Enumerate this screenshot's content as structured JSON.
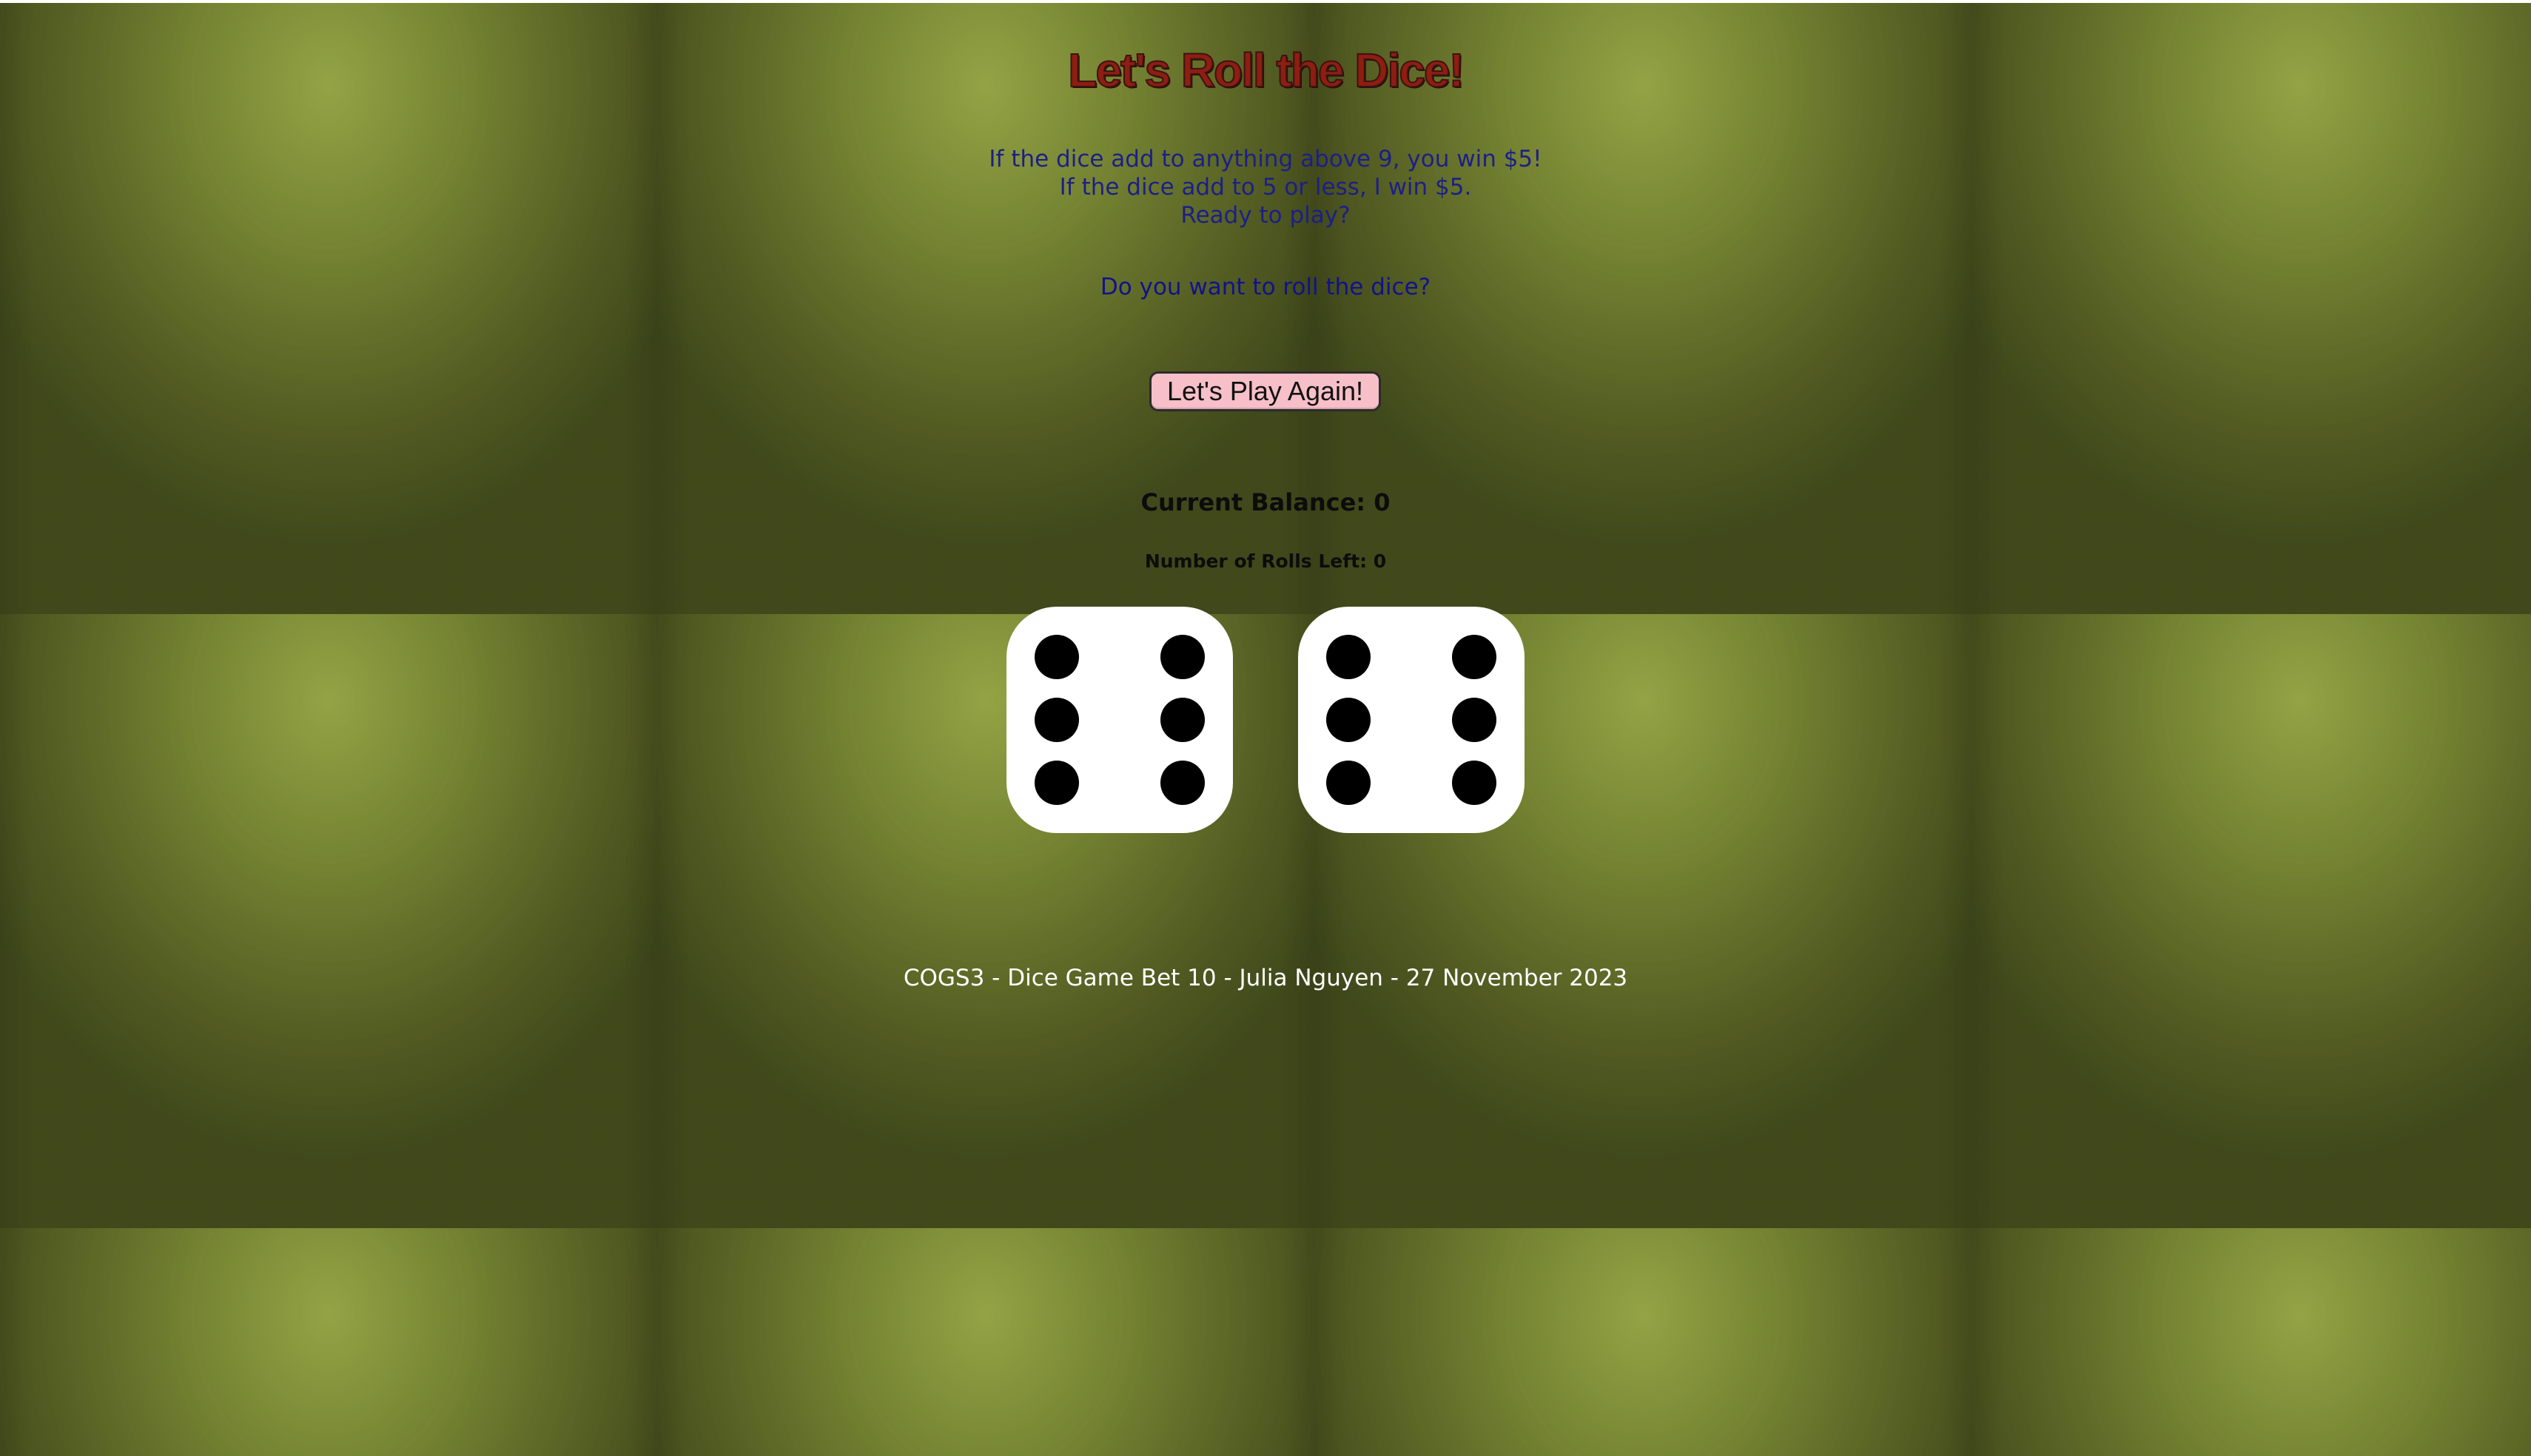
{
  "game": {
    "title": "Let's Roll the Dice!",
    "rules": [
      "If the dice add to anything above 9, you win $5!",
      "If the dice add to 5 or less, I win $5.",
      "Ready to play?"
    ],
    "question": "Do you want to roll the dice?",
    "play_button_label": "Let's Play Again!",
    "balance_text": "Current Balance: 0",
    "rolls_left_text": "Number of Rolls Left: 0",
    "dice": [
      {
        "value": 6
      },
      {
        "value": 6
      }
    ],
    "footer": "COGS3 - Dice Game Bet 10 - Julia Nguyen - 27 November 2023"
  },
  "colors": {
    "title_red": "#8e1d12",
    "rules_blue": "#1c1f86",
    "button_pink": "#f7bfc8",
    "felt_green": "#6e7a2e"
  }
}
